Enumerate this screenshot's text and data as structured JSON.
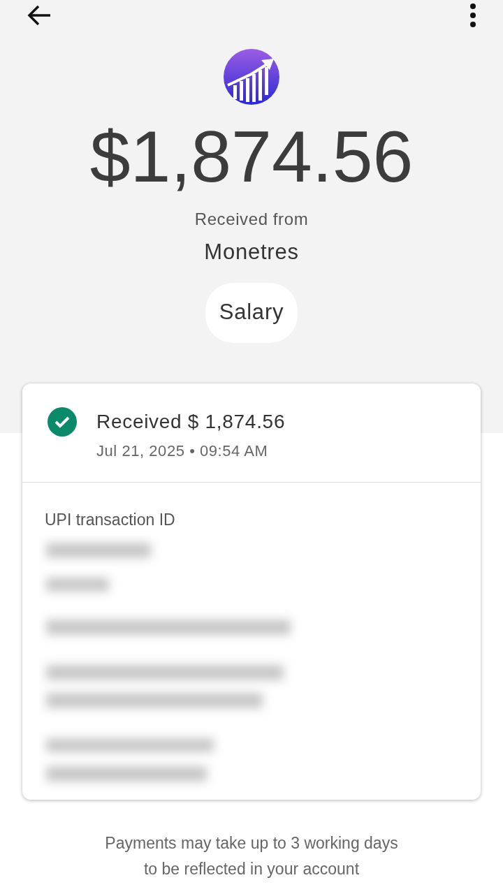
{
  "amount": "$1,874.56",
  "received_from_label": "Received from",
  "sender": "Monetres",
  "note": "Salary",
  "status": {
    "kind": "success",
    "title": "Received $ 1,874.56",
    "timestamp": "Jul 21, 2025 • 09:54 AM"
  },
  "transaction_id_label": "UPI transaction ID",
  "footer_note": [
    "Payments may take up to 3 working days",
    "to be reflected in your account"
  ]
}
